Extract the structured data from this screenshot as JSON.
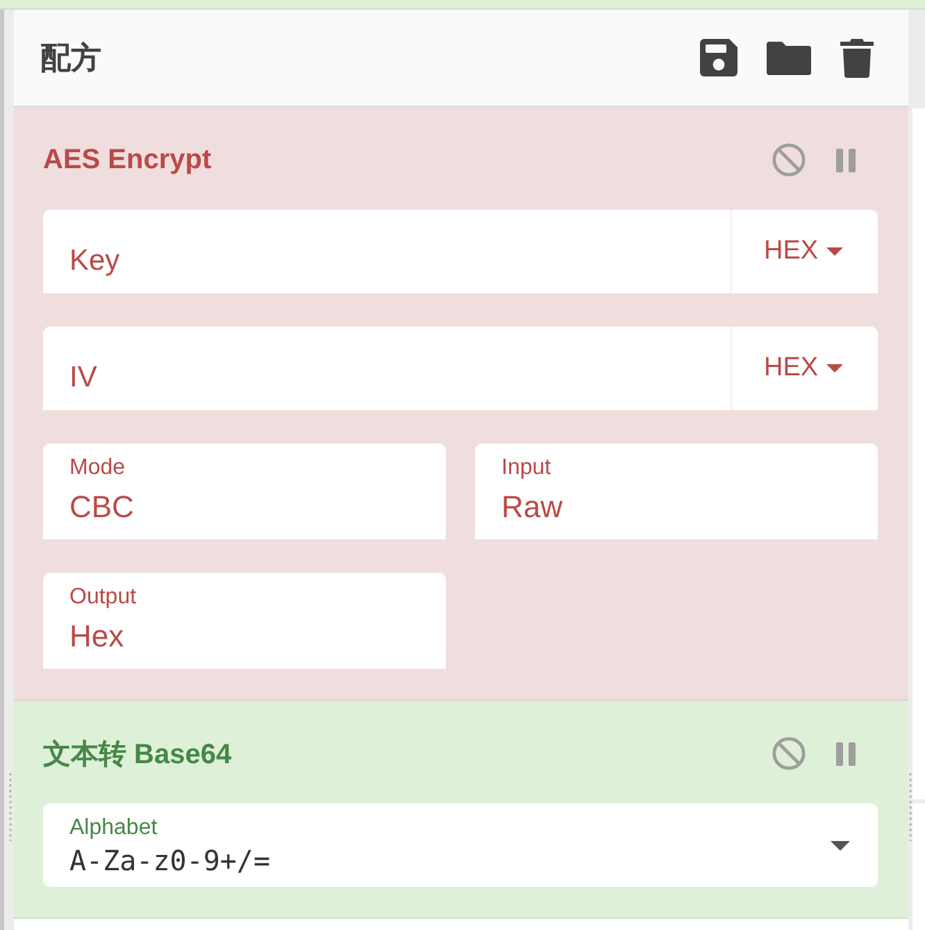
{
  "recipe": {
    "title": "配方"
  },
  "operations": [
    {
      "name": "AES Encrypt",
      "error": true,
      "args": [
        {
          "kind": "toggle",
          "placeholder": "Key",
          "toggle": "HEX"
        },
        {
          "kind": "toggle",
          "placeholder": "IV",
          "toggle": "HEX"
        },
        {
          "kind": "select",
          "label": "Mode",
          "value": "CBC"
        },
        {
          "kind": "select",
          "label": "Input",
          "value": "Raw"
        },
        {
          "kind": "select",
          "label": "Output",
          "value": "Hex"
        }
      ]
    },
    {
      "name": "文本转 Base64",
      "error": false,
      "args": [
        {
          "kind": "combo",
          "label": "Alphabet",
          "value": "A-Za-z0-9+/="
        }
      ]
    }
  ]
}
